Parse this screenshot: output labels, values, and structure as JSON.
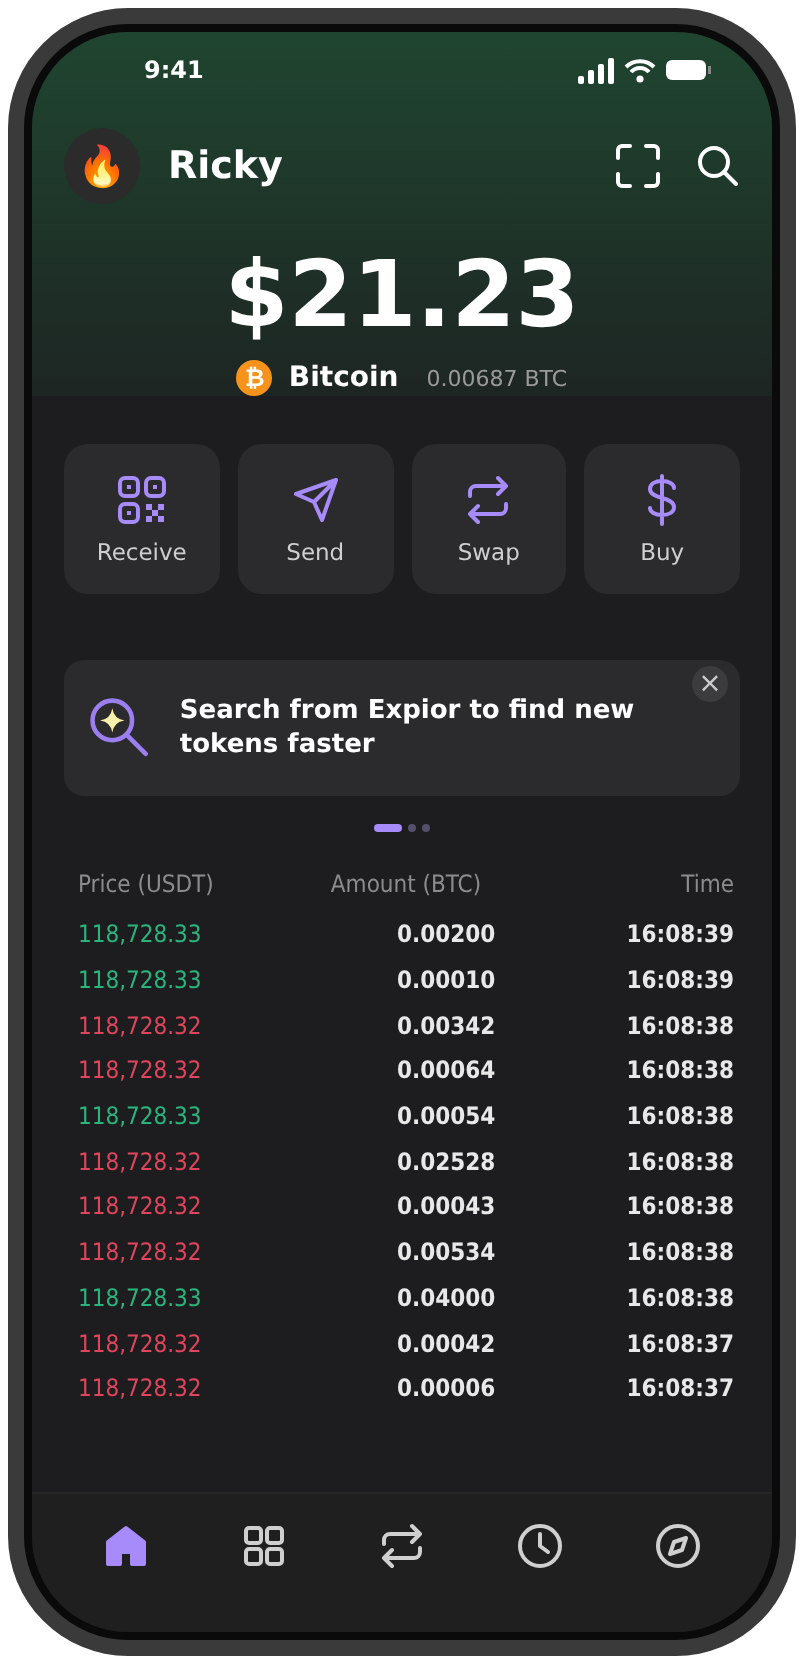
{
  "status_bar": {
    "time": "9:41"
  },
  "header": {
    "avatar": "🔥",
    "name": "Ricky"
  },
  "balance": {
    "amount": "$21.23",
    "coin_symbol": "₿",
    "coin": "Bitcoin",
    "holding": "0.00687 BTC"
  },
  "actions": [
    {
      "label": "Receive"
    },
    {
      "label": "Send"
    },
    {
      "label": "Swap"
    },
    {
      "label": "Buy"
    }
  ],
  "banner": {
    "text": "Search from Expior to find new tokens faster",
    "close": "×"
  },
  "banner_pages": [
    {
      "selected": true
    },
    {
      "selected": false
    },
    {
      "selected": false
    }
  ],
  "trades": {
    "columns": [
      "Price (USDT)",
      "Amount (BTC)",
      "Time"
    ],
    "rows": [
      {
        "color": "#2bb57e",
        "price": "118,728.33",
        "amount": "0.00200",
        "time": "16:08:39"
      },
      {
        "color": "#2bb57e",
        "price": "118,728.33",
        "amount": "0.00010",
        "time": "16:08:39"
      },
      {
        "color": "#e0455c",
        "price": "118,728.32",
        "amount": "0.00342",
        "time": "16:08:38"
      },
      {
        "color": "#e0455c",
        "price": "118,728.32",
        "amount": "0.00064",
        "time": "16:08:38"
      },
      {
        "color": "#2bb57e",
        "price": "118,728.33",
        "amount": "0.00054",
        "time": "16:08:38"
      },
      {
        "color": "#e0455c",
        "price": "118,728.32",
        "amount": "0.02528",
        "time": "16:08:38"
      },
      {
        "color": "#e0455c",
        "price": "118,728.32",
        "amount": "0.00043",
        "time": "16:08:38"
      },
      {
        "color": "#e0455c",
        "price": "118,728.32",
        "amount": "0.00534",
        "time": "16:08:38"
      },
      {
        "color": "#2bb57e",
        "price": "118,728.33",
        "amount": "0.04000",
        "time": "16:08:38"
      },
      {
        "color": "#e0455c",
        "price": "118,728.32",
        "amount": "0.00042",
        "time": "16:08:37"
      },
      {
        "color": "#e0455c",
        "price": "118,728.32",
        "amount": "0.00006",
        "time": "16:08:37"
      }
    ]
  },
  "tab_bar": [
    {
      "selected": true
    },
    {
      "selected": false
    },
    {
      "selected": false
    },
    {
      "selected": false
    },
    {
      "selected": false
    }
  ]
}
